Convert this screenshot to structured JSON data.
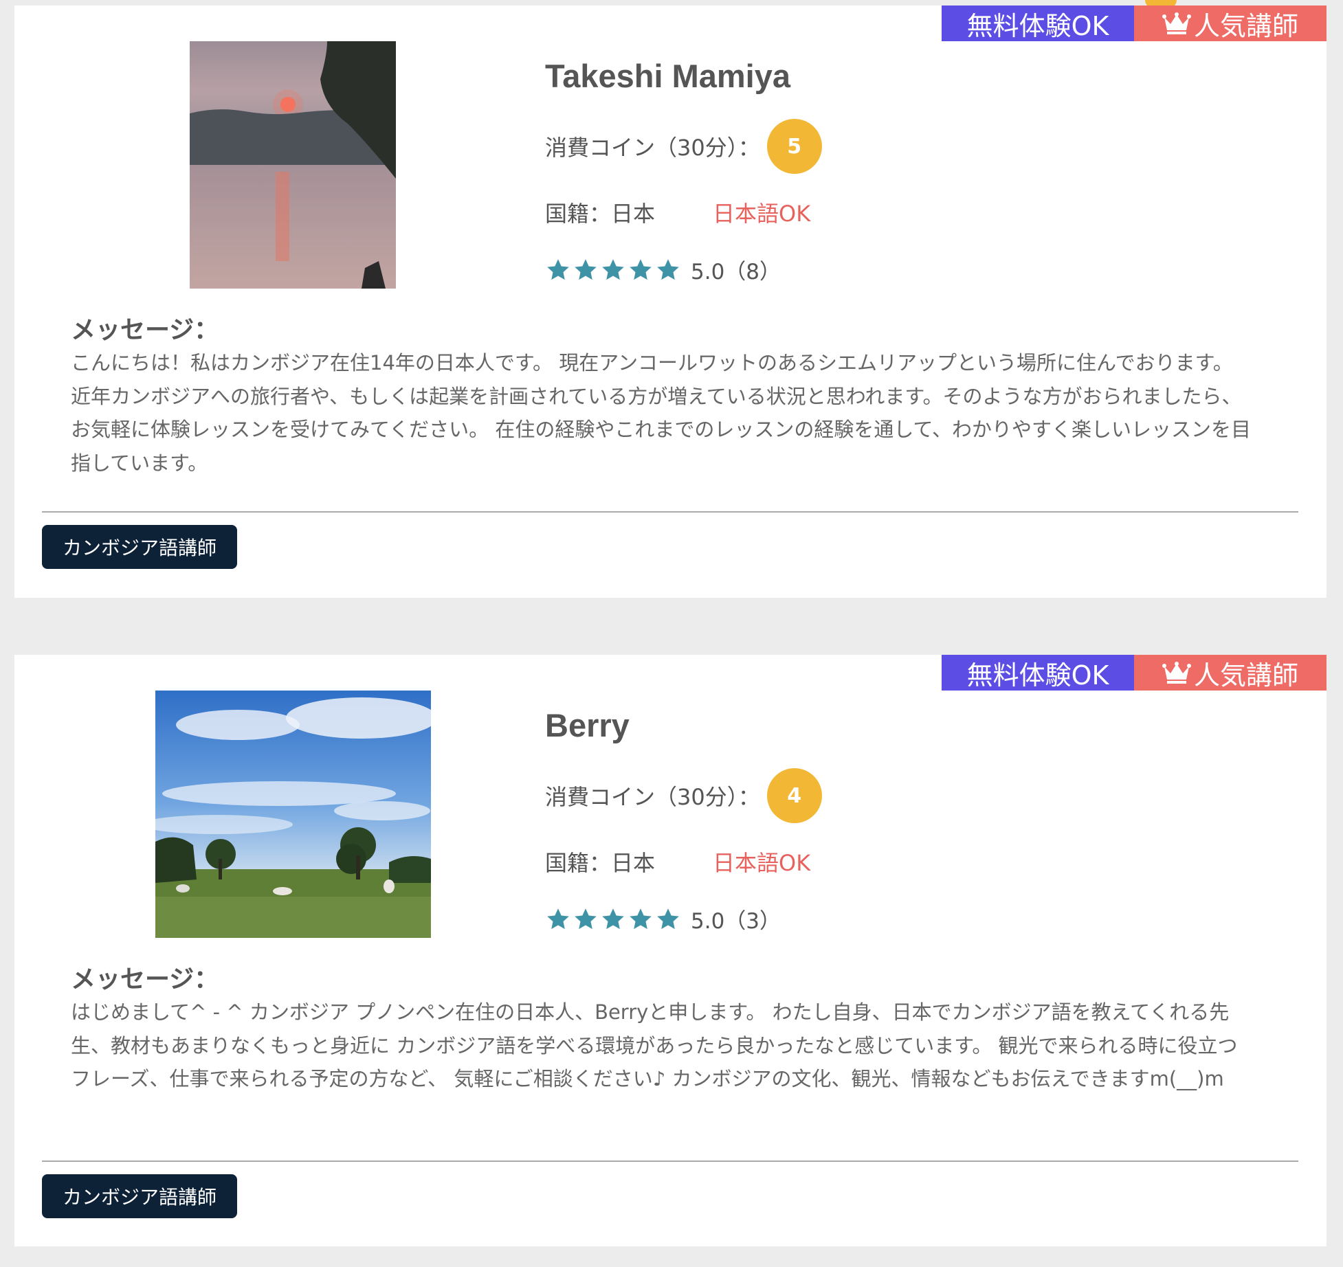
{
  "teachers": [
    {
      "name": "Takeshi Mamiya",
      "badges": {
        "trial": "無料体験OK",
        "popular": "人気講師"
      },
      "coin_label": "消費コイン（30分）：",
      "coin": "5",
      "nationality": "国籍：日本",
      "japanese_ok": "日本語OK",
      "rating": 5.0,
      "rating_text": "5.0（8）",
      "message_label": "メッセージ：",
      "message": "こんにちは！私はカンボジア在住14年の日本人です。 現在アンコールワットのあるシエムリアップという場所に住んでおります。 近年カンボジアへの旅行者や、もしくは起業を計画されている方が増えている状況と思われます。そのような方がおられましたら、お気軽に体験レッスンを受けてみてください。 在住の経験やこれまでのレッスンの経験を通して、わかりやすく楽しいレッスンを目指しています。",
      "tag": "カンボジア語講師"
    },
    {
      "name": "Berry",
      "badges": {
        "trial": "無料体験OK",
        "popular": "人気講師"
      },
      "coin_label": "消費コイン（30分）：",
      "coin": "4",
      "nationality": "国籍：日本",
      "japanese_ok": "日本語OK",
      "rating": 5.0,
      "rating_text": "5.0（3）",
      "message_label": "メッセージ：",
      "message": "はじめまして^ - ^ カンボジア プノンペン在住の日本人、Berryと申します。 わたし自身、日本でカンボジア語を教えてくれる先生、教材もあまりなくもっと身近に カンボジア語を学べる環境があったら良かったなと感じています。 観光で来られる時に役立つフレーズ、仕事で来られる予定の方など、 気軽にご相談ください♪ カンボジアの文化、観光、情報などもお伝えできますm(__)m",
      "tag": "カンボジア語講師"
    }
  ],
  "colors": {
    "trial_badge": "#5c4ee5",
    "popular_badge": "#ee6b66",
    "coin_badge": "#f2b835",
    "japanese_ok": "#e8625d",
    "star": "#3f93a6",
    "tag_bg": "#0d2137"
  },
  "icons": {
    "badge": "crown-icon",
    "rating": "star-icon"
  }
}
